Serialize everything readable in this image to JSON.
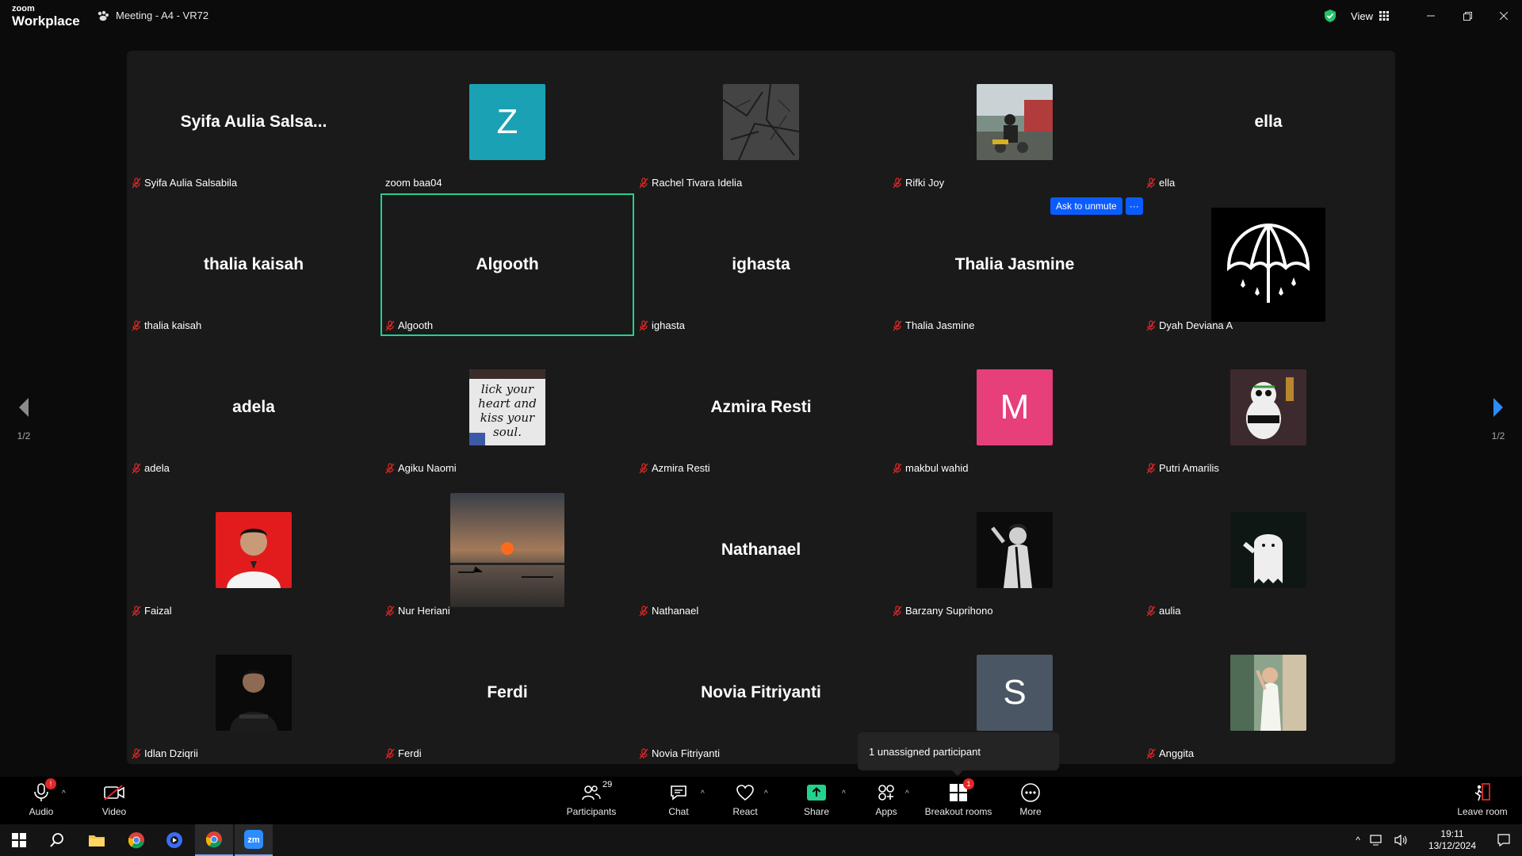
{
  "titlebar": {
    "brand_top": "zoom",
    "brand_bottom": "Workplace",
    "meeting_title": "Meeting - A4 - VR72",
    "view_label": "View"
  },
  "participants": [
    {
      "label": "Syifa Aulia Salsabila",
      "display": "Syifa Aulia Salsa...",
      "kind": "name"
    },
    {
      "label": "zoom baa04",
      "display": "Z",
      "kind": "letter",
      "color": "#1aa1b3",
      "muted": false
    },
    {
      "label": "Rachel Tivara Idelia",
      "kind": "photo",
      "photo": "branches"
    },
    {
      "label": "Rifki Joy",
      "kind": "photo",
      "photo": "rider"
    },
    {
      "label": "ella",
      "display": "ella",
      "kind": "name"
    },
    {
      "label": "thalia kaisah",
      "display": "thalia kaisah",
      "kind": "name"
    },
    {
      "label": "Algooth",
      "display": "Algooth",
      "kind": "name",
      "active": true
    },
    {
      "label": "ighasta",
      "display": "ighasta",
      "kind": "name"
    },
    {
      "label": "Thalia Jasmine",
      "display": "Thalia Jasmine",
      "kind": "name"
    },
    {
      "label": "Dyah Deviana A",
      "kind": "photo",
      "photo": "umbrella"
    },
    {
      "label": "adela",
      "display": "adela",
      "kind": "name"
    },
    {
      "label": "Agiku Naomi",
      "kind": "photo",
      "photo": "shirt-text"
    },
    {
      "label": "Azmira Resti",
      "display": "Azmira Resti",
      "kind": "name"
    },
    {
      "label": "makbul wahid",
      "display": "M",
      "kind": "letter",
      "color": "#e63f7a"
    },
    {
      "label": "Putri Amarilis",
      "kind": "photo",
      "photo": "panda"
    },
    {
      "label": "Faizal",
      "kind": "photo",
      "photo": "portrait-red"
    },
    {
      "label": "Nur Heriani",
      "kind": "photo",
      "photo": "sunset"
    },
    {
      "label": "Nathanael",
      "display": "Nathanael",
      "kind": "name"
    },
    {
      "label": "Barzany Suprihono",
      "kind": "photo",
      "photo": "singer"
    },
    {
      "label": "aulia",
      "kind": "photo",
      "photo": "ghost"
    },
    {
      "label": "Idlan Dziqrii",
      "kind": "photo",
      "photo": "portrait-dark"
    },
    {
      "label": "Ferdi",
      "display": "Ferdi",
      "kind": "name"
    },
    {
      "label": "Novia Fitriyanti",
      "display": "Novia Fitriyanti",
      "kind": "name"
    },
    {
      "label": "",
      "display": "S",
      "kind": "letter",
      "color": "#4a5663",
      "nolabel": true
    },
    {
      "label": "Anggita",
      "kind": "photo",
      "photo": "portrait-light"
    }
  ],
  "ask_unmute": {
    "label": "Ask to unmute",
    "more": "···"
  },
  "pager": {
    "left": "1/2",
    "right": "1/2"
  },
  "tooltip": {
    "text": "1 unassigned participant"
  },
  "toolbar": {
    "audio": "Audio",
    "video": "Video",
    "participants": "Participants",
    "participants_count": "29",
    "chat": "Chat",
    "react": "React",
    "share": "Share",
    "apps": "Apps",
    "breakout": "Breakout rooms",
    "breakout_badge": "1",
    "more": "More",
    "leave": "Leave room",
    "audio_badge": "!"
  },
  "taskbar": {
    "time": "19:11",
    "date": "13/12/2024"
  },
  "colors": {
    "accent": "#0b5cff",
    "active_border": "#23d18b",
    "share_green": "#23d18b",
    "mute_red": "#e02828"
  }
}
